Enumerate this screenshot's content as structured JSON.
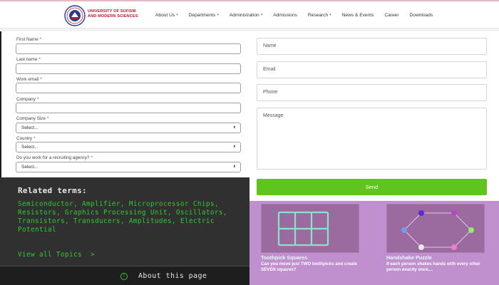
{
  "header": {
    "brand_line1": "UNIVERSITY OF SUFISM",
    "brand_line2": "AND MODERN SCIENCES",
    "nav": [
      {
        "label": "About Us",
        "dropdown": true
      },
      {
        "label": "Departments",
        "dropdown": true
      },
      {
        "label": "Administration",
        "dropdown": true
      },
      {
        "label": "Admissions",
        "dropdown": false
      },
      {
        "label": "Research",
        "dropdown": true
      },
      {
        "label": "News & Events",
        "dropdown": false
      },
      {
        "label": "Career",
        "dropdown": false
      },
      {
        "label": "Downloads",
        "dropdown": false
      }
    ]
  },
  "lead_form": {
    "required_mark": "*",
    "first_name_label": "First Name",
    "last_name_label": "Last name",
    "work_email_label": "Work email",
    "company_label": "Company",
    "company_size_label": "Company Size",
    "company_size_value": "Select...",
    "country_label": "Country",
    "country_value": "Select...",
    "agency_label": "Do you work for a recruiting agency?",
    "agency_value": "Select..."
  },
  "contact_form": {
    "name_placeholder": "Name",
    "email_placeholder": "Email",
    "phone_placeholder": "Phone",
    "message_placeholder": "Message",
    "send_label": "Send",
    "send_color": "#5fc41d"
  },
  "related_terms": {
    "title": "Related terms:",
    "terms": "Semiconductor, Amplifier, Microprocessor Chips, Resistors, Graphics Processing Unit, Oscillators, Transistors, Transducers, Amplitudes, Electric Potential",
    "view_all": "View all Topics",
    "about": "About this page",
    "accent_color": "#31c931"
  },
  "puzzles": [
    {
      "title": "Toothpick Squares",
      "description": "Can you move just TWO toothpicks and create SEVEN squares?"
    },
    {
      "title": "Handshake Puzzle",
      "description": "If each person shakes hands with every other person exactly once,..."
    }
  ]
}
